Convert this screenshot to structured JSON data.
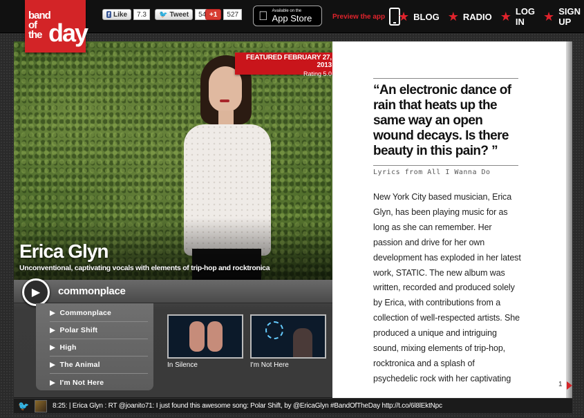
{
  "logo": {
    "line1": "band",
    "line2": "of",
    "line3": "the",
    "big": "day"
  },
  "social": {
    "facebook": {
      "label": "Like",
      "count": "7.3"
    },
    "twitter": {
      "label": "Tweet",
      "count": "546"
    },
    "gplus": {
      "label": "+1",
      "count": "527"
    }
  },
  "appstore": {
    "small": "Available on the",
    "big": "App Store"
  },
  "nav": {
    "preview": "Preview the app",
    "links": [
      "BLOG",
      "RADIO",
      "LOG IN",
      "SIGN UP"
    ]
  },
  "feature": {
    "date": "FEATURED FEBRUARY 27, 2013",
    "rating": "Rating 5.0",
    "artist": "Erica Glyn",
    "tagline": "Unconventional, captivating vocals with elements of trip-hop and rocktronica"
  },
  "player": {
    "now_playing": "commonplace",
    "tracks": [
      "Commonplace",
      "Polar Shift",
      "High",
      "The Animal",
      "I'm Not Here"
    ],
    "videos": [
      {
        "caption": "In Silence"
      },
      {
        "caption": "I'm Not Here"
      }
    ]
  },
  "article": {
    "quote": "“An electronic dance of rain that heats up the same way an open wound decays. Is there beauty in this pain? ”",
    "quote_source": "Lyrics from All I Wanna Do",
    "body": "New York City based musician, Erica Glyn, has been playing music for as long as she can remember. Her passion and drive for her own development has exploded in her latest work, STATIC. The new album was written, recorded and produced solely by Erica, with contributions from a collection of well-respected artists. She produced a unique and intriguing sound, mixing elements of trip-hop, rocktronica and a splash of psychedelic rock with her captivating",
    "page": "1"
  },
  "ticker": {
    "text": "8:25: | Erica Glyn : RT @joanito71: I just found this awesome song: Polar Shift, by @EricaGlyn #BandOfTheDay http://t.co/6l8lEktNpc"
  },
  "colors": {
    "brand_red": "#d32427",
    "topbar": "#111111"
  }
}
